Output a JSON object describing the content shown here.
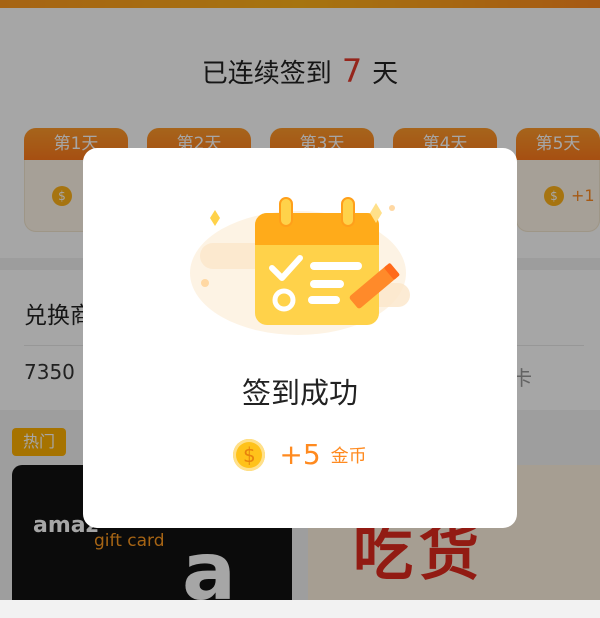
{
  "checkin": {
    "prefix": "已连续签到",
    "count": "7",
    "suffix": "天",
    "days": [
      {
        "label": "第1天",
        "reward": ""
      },
      {
        "label": "第2天",
        "reward": ""
      },
      {
        "label": "第3天",
        "reward": ""
      },
      {
        "label": "第4天",
        "reward": ""
      },
      {
        "label": "第5天",
        "reward": "+1"
      }
    ]
  },
  "exchange": {
    "title": "兑换商",
    "balance": "7350",
    "balance_suffix": "卡"
  },
  "goods": {
    "hot_label": "热门",
    "amazon_brand": "amaz",
    "amazon_gift": "gift card",
    "amazon_letter": "a",
    "food_text": "吃货"
  },
  "modal": {
    "title": "签到成功",
    "reward_amount": "+5",
    "reward_unit": "金币"
  },
  "icons": {
    "coin": "coin-icon",
    "calendar": "calendar-checklist-icon"
  },
  "colors": {
    "accent": "#ff8a1f",
    "streak_number": "#e53a2b",
    "hot_badge": "#ffb100"
  }
}
